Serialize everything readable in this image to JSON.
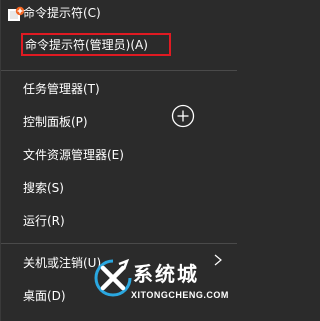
{
  "menu": {
    "items": [
      {
        "label": "命令提示符(C)"
      },
      {
        "label": "命令提示符(管理员)(A)"
      },
      {
        "label": "任务管理器(T)"
      },
      {
        "label": "控制面板(P)"
      },
      {
        "label": "文件资源管理器(E)"
      },
      {
        "label": "搜索(S)"
      },
      {
        "label": "运行(R)"
      },
      {
        "label": "关机或注销(U)"
      },
      {
        "label": "桌面(D)"
      }
    ]
  },
  "watermark": {
    "name": "系统城",
    "url": "XITONGCHENG.COM"
  },
  "colors": {
    "background": "#2b2b2b",
    "highlight_border": "#e01a22",
    "text": "#ffffff"
  },
  "icons": {
    "corner": "cmd-plus-icon",
    "add": "plus-circle-icon",
    "submenu": "chevron-right-icon"
  }
}
